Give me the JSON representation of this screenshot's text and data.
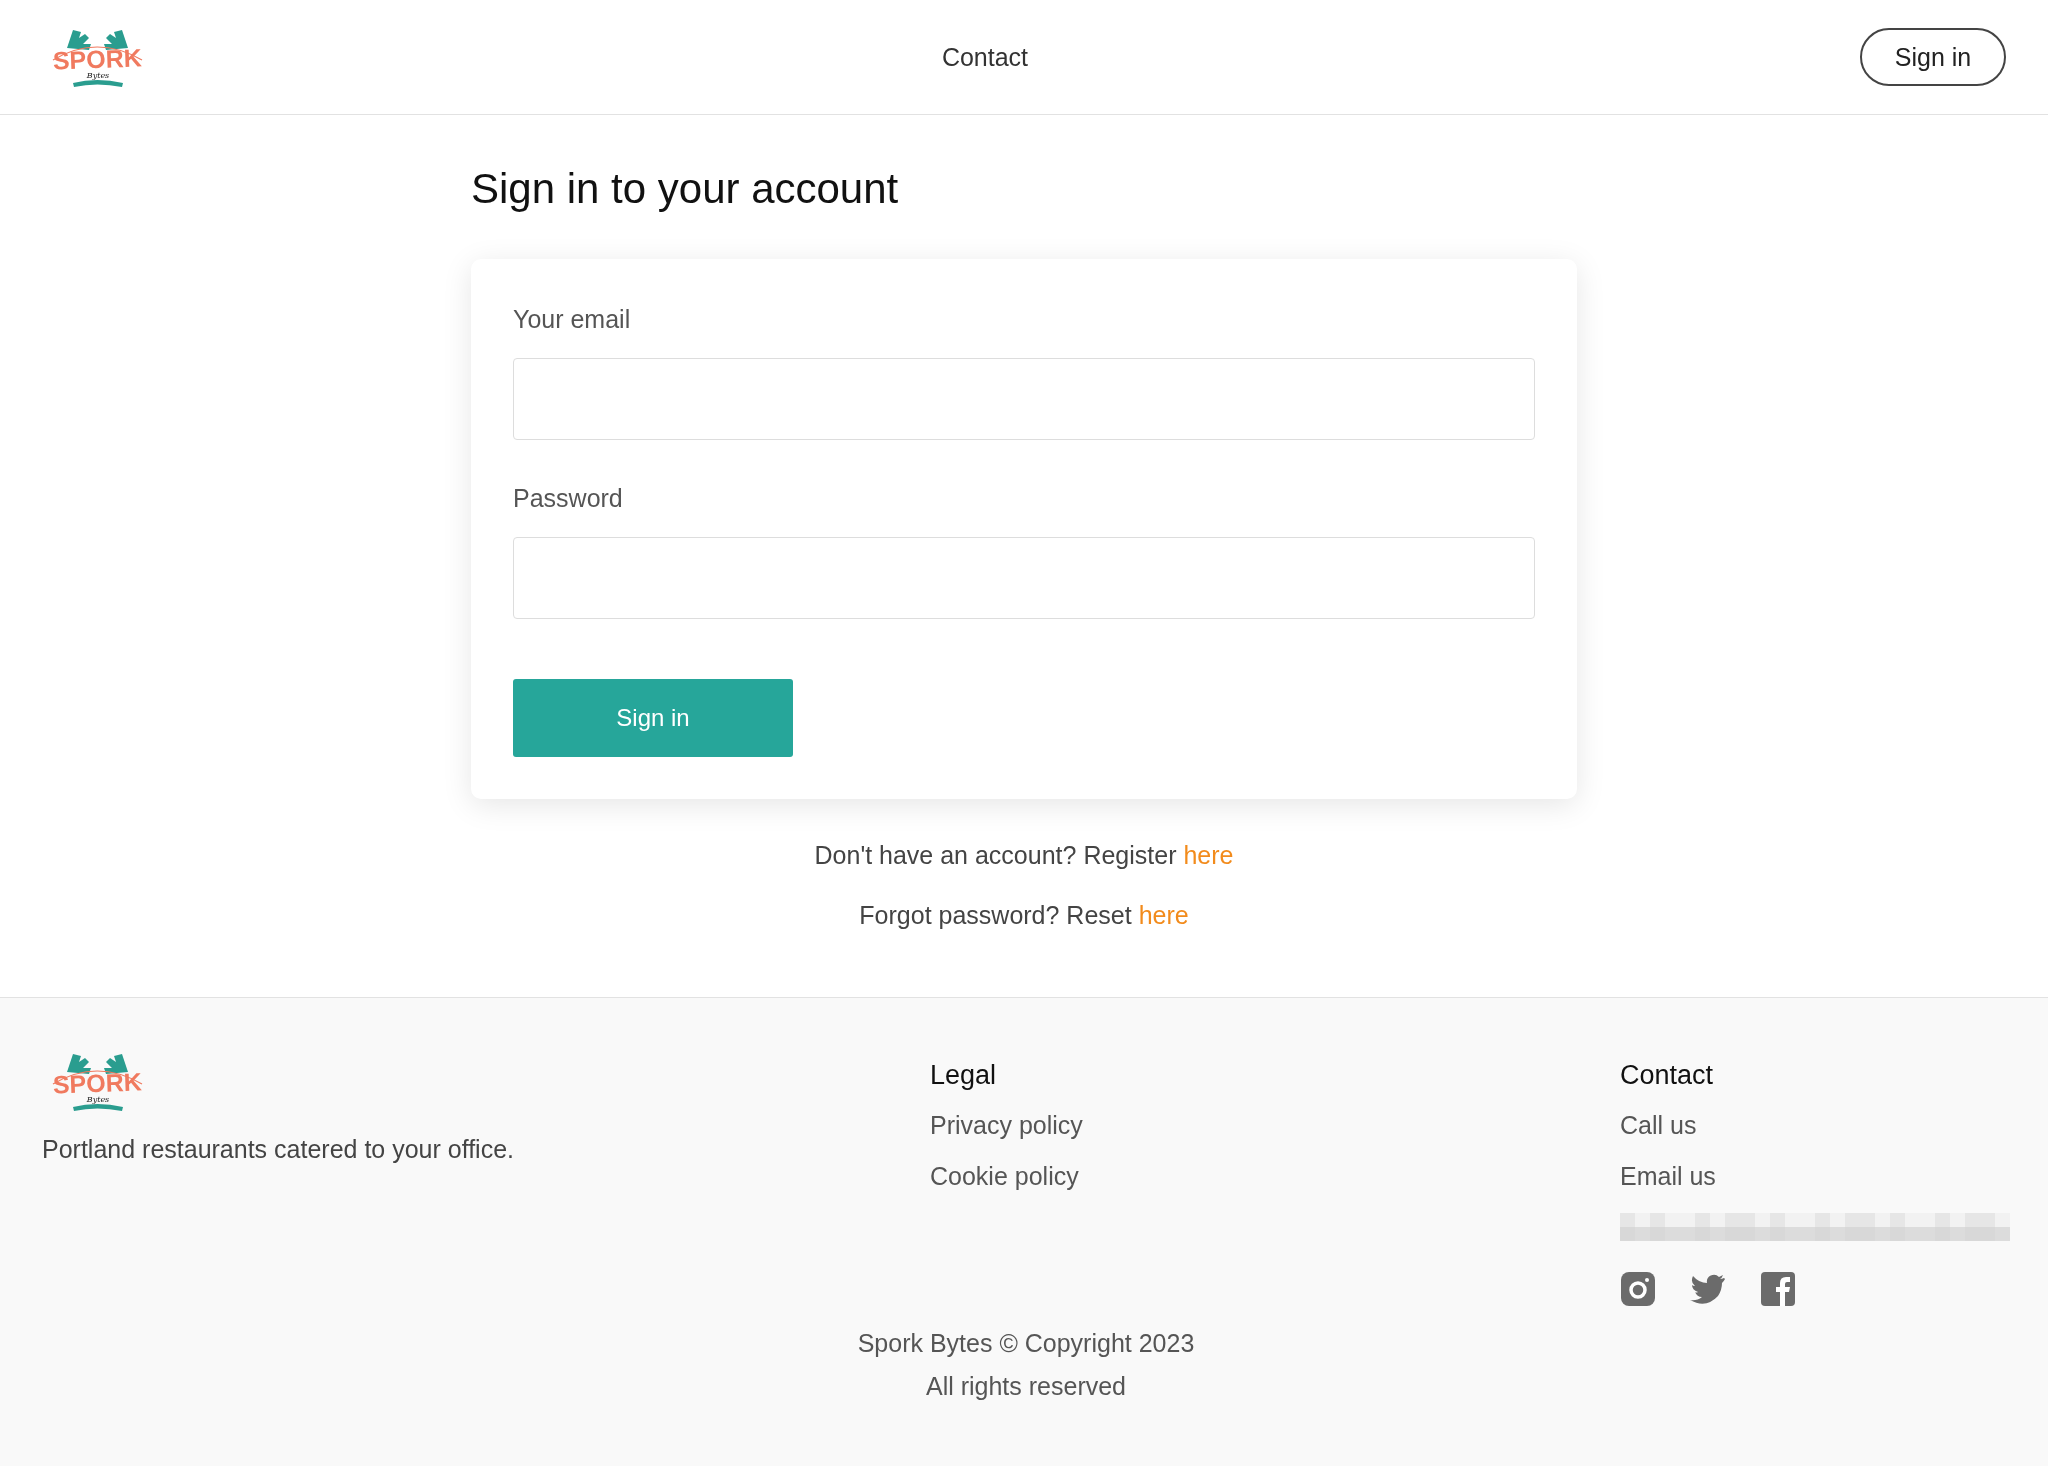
{
  "header": {
    "logo": {
      "word": "SPORK",
      "subword": "Bytes"
    },
    "nav": [
      {
        "label": "Contact"
      }
    ],
    "sign_in_button": "Sign in"
  },
  "title": "Sign in to your account",
  "form": {
    "fields": [
      {
        "label": "Your email"
      },
      {
        "label": "Password"
      }
    ],
    "submit": "Sign in"
  },
  "links": [
    {
      "text": "Don't have an account? Register",
      "link": "here"
    },
    {
      "text": "Forgot password? Reset",
      "link": "here"
    }
  ],
  "footer": {
    "logo": {
      "word": "SPORK",
      "subword": "Bytes"
    },
    "tagline": "Portland restaurants catered to your office.",
    "columns": [
      {
        "heading": "Legal",
        "items": [
          "Privacy policy",
          "Cookie policy"
        ]
      },
      {
        "heading": "Contact",
        "items": [
          "Call us",
          "Email us"
        ],
        "social": [
          {
            "kind": "instagram"
          },
          {
            "kind": "twitter"
          },
          {
            "kind": "facebook"
          }
        ]
      }
    ],
    "copyright": [
      "Spork Bytes © Copyright 2023",
      "All rights reserved"
    ]
  }
}
